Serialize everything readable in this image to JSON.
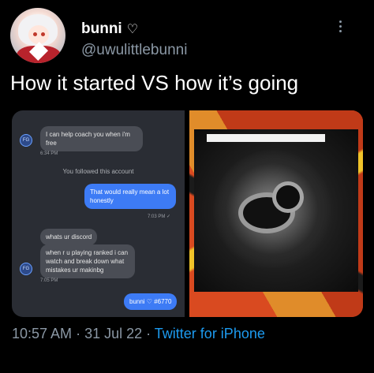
{
  "user": {
    "display_name": "bunni",
    "name_icon": "heart-outline-icon",
    "heart_glyph": "♡",
    "handle": "@uwulittlebunni"
  },
  "tweet": {
    "text": "How it started VS how it’s going"
  },
  "chat": {
    "messages": [
      {
        "from": "them",
        "text": "I can help coach you when i'm free",
        "time": "6:34 PM"
      },
      {
        "system": "You followed this account"
      },
      {
        "from": "me",
        "text": "That would really mean a lot honestly",
        "time": "7:03 PM ✓"
      },
      {
        "from": "them",
        "text": "whats ur discord"
      },
      {
        "from": "them",
        "text": "when r u playing ranked i can watch and break down what mistakes ur makinbg",
        "time": "7:05 PM"
      },
      {
        "from": "me",
        "text": "bunni ♡ #6770"
      }
    ]
  },
  "footer": {
    "time": "10:57 AM",
    "sep1": " · ",
    "date": "31 Jul 22",
    "sep2": " · ",
    "source": "Twitter for iPhone"
  },
  "colors": {
    "background": "#000000",
    "secondary_text": "#8b98a5",
    "link": "#1d9bf0",
    "sent_bubble": "#3d7bf5",
    "received_bubble": "#4a4d55"
  }
}
